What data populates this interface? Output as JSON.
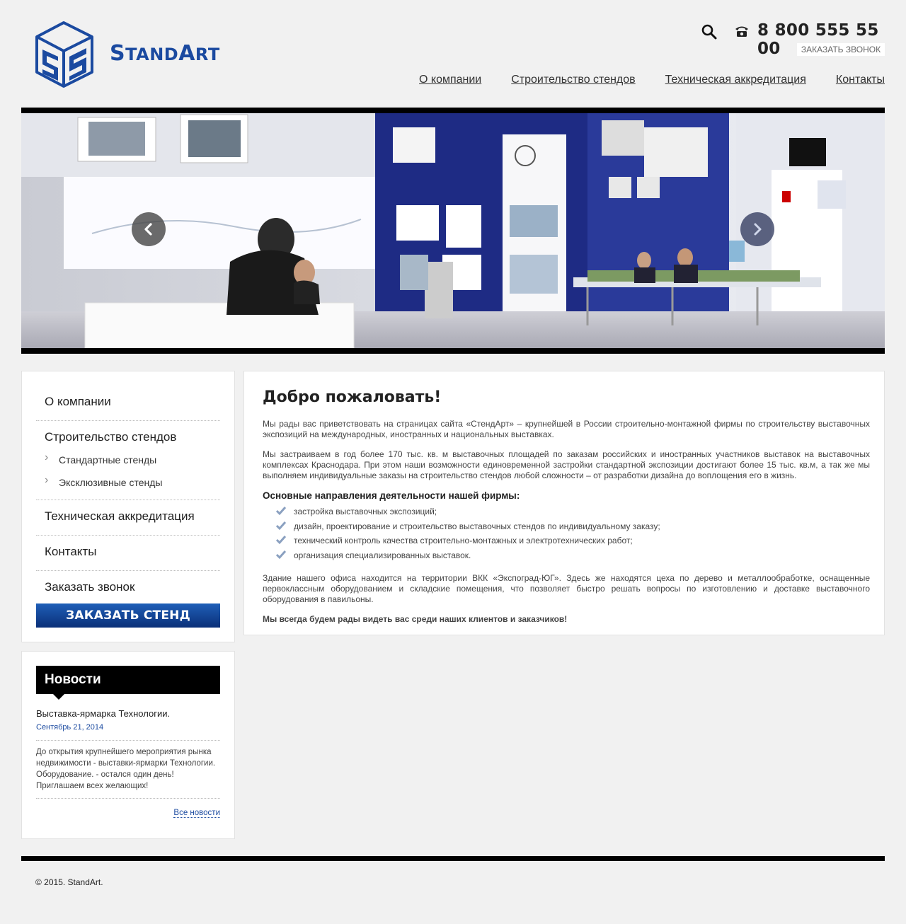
{
  "header": {
    "logo_text_a": "S",
    "logo_text_b": "TAND",
    "logo_text_c": "A",
    "logo_text_d": "RT",
    "phone": "8 800 555 55 00",
    "callback_label": "ЗАКАЗАТЬ ЗВОНОК",
    "nav": [
      "О компании",
      "Строительство стендов",
      "Техническая аккредитация",
      "Контакты"
    ]
  },
  "sidebar": {
    "items": [
      {
        "label": "О компании"
      },
      {
        "label": "Строительство стендов",
        "children": [
          "Стандартные стенды",
          "Эксклюзивные стенды"
        ]
      },
      {
        "label": "Техническая аккредитация"
      },
      {
        "label": "Контакты"
      },
      {
        "label": "Заказать звонок"
      }
    ],
    "order_button": "ЗАКАЗАТЬ СТЕНД"
  },
  "news": {
    "heading": "Новости",
    "title": "Выставка-ярмарка Технологии.",
    "date": "Сентябрь 21, 2014",
    "text": "До открытия крупнейшего мероприятия рынка недвижимости - выставки-ярмарки Технологии. Оборудование. - остался один день! Приглашаем всех желающих!",
    "all_link": "Все новости"
  },
  "main": {
    "title": "Добро пожаловать!",
    "p1": "Мы рады вас приветствовать на страницах сайта «СтендАрт» – крупнейшей в России строительно-монтажной фирмы по строительству выставочных экспозиций на международных, иностранных и национальных выставках.",
    "p2": "Мы застраиваем в год более 170 тыс. кв. м выставочных площадей по заказам российских и иностранных участников выставок на выставочных комплексах Краснодара. При этом наши возможности единовременной застройки стандартной экспозиции достигают более 15 тыс. кв.м, а так же мы выполняем индивидуальные заказы на строительство стендов любой сложности – от разработки дизайна до воплощения его в жизнь.",
    "list_heading": "Основные направления деятельности нашей фирмы:",
    "list": [
      "застройка выставочных экспозиций;",
      "дизайн, проектирование и строительство выставочных стендов по индивидуальному заказу;",
      "технический контроль качества строительно-монтажных и электротехнических работ;",
      "организация специализированных выставок."
    ],
    "p3": "Здание нашего офиса находится на территории ВКК «Экспоград-ЮГ». Здесь же находятся цеха по дерево и металлообработке, оснащенные первоклассным оборудованием и складские помещения, что позволяет быстро решать вопросы по изготовлению и доставке выставочного оборудования в павильоны.",
    "closing": "Мы всегда будем рады видеть вас среди наших клиентов и заказчиков!"
  },
  "footer": {
    "copyright": "© 2015. StandArt."
  },
  "colors": {
    "brand_blue": "#1b4aa0",
    "button_gradient_top": "#1f5fb8",
    "button_gradient_bottom": "#0a2f78"
  },
  "icons": [
    "cube-logo-icon",
    "search-icon",
    "phone-icon",
    "chevron-left-icon",
    "chevron-right-icon",
    "checkmark-icon",
    "chevron-right-small-icon"
  ]
}
